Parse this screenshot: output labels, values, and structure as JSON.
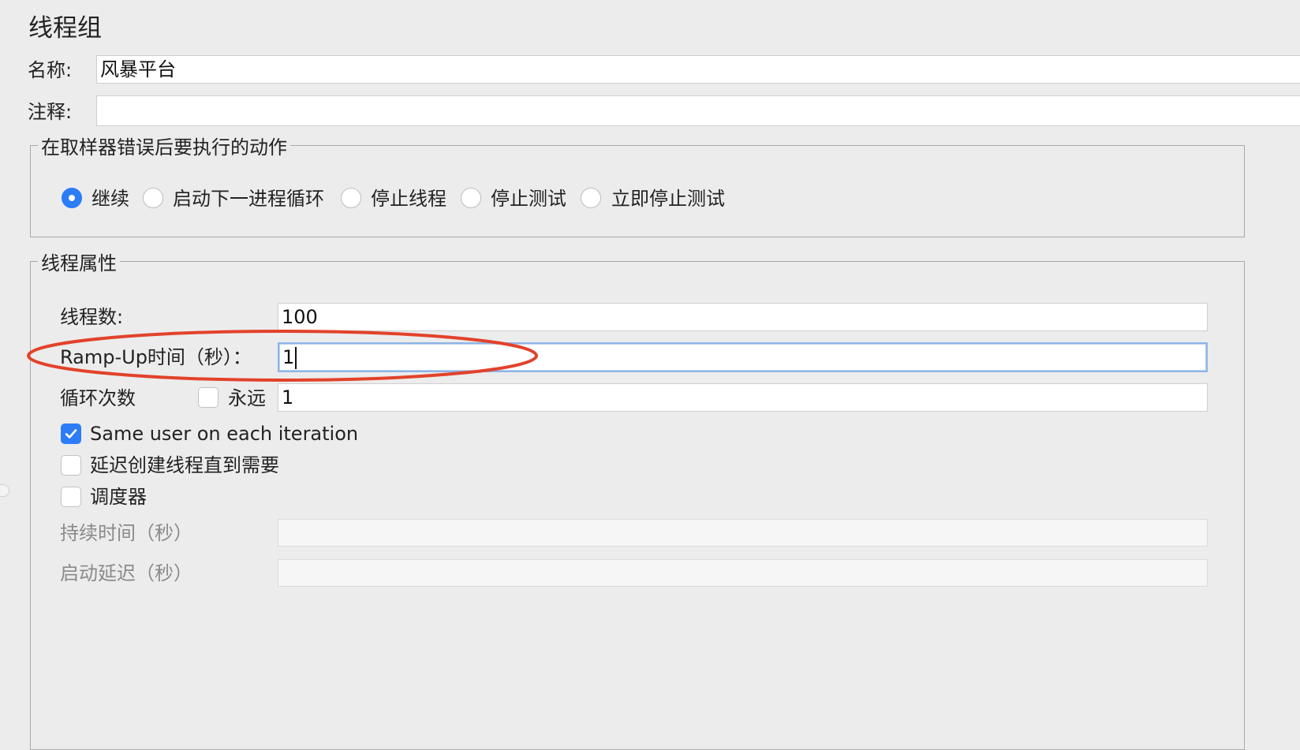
{
  "panel_title": "线程组",
  "name_label": "名称:",
  "name_value": "风暴平台",
  "comment_label": "注释:",
  "comment_value": "",
  "error_action": {
    "legend": "在取样器错误后要执行的动作",
    "options": [
      {
        "label": "继续",
        "checked": true
      },
      {
        "label": "启动下一进程循环",
        "checked": false
      },
      {
        "label": "停止线程",
        "checked": false
      },
      {
        "label": "停止测试",
        "checked": false
      },
      {
        "label": "立即停止测试",
        "checked": false
      }
    ]
  },
  "thread_props": {
    "legend": "线程属性",
    "threads_label": "线程数:",
    "threads_value": "100",
    "rampup_label": "Ramp-Up时间（秒）：",
    "rampup_value": "1",
    "loop_label": "循环次数",
    "forever_label": "永远",
    "forever_checked": false,
    "loop_value": "1",
    "same_user_label": "Same user on each iteration",
    "same_user_checked": true,
    "delay_create_label": "延迟创建线程直到需要",
    "delay_create_checked": false,
    "scheduler_label": "调度器",
    "scheduler_checked": false,
    "duration_label": "持续时间（秒）",
    "duration_value": "",
    "startup_delay_label": "启动延迟（秒）",
    "startup_delay_value": ""
  },
  "annotation_color": "#e2422b"
}
